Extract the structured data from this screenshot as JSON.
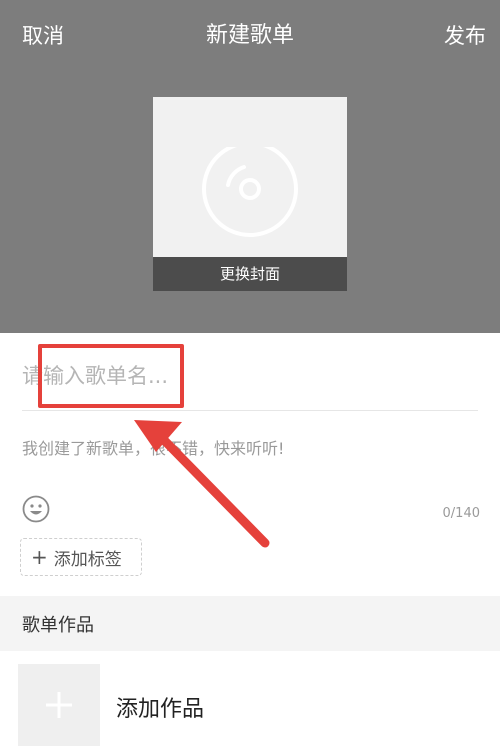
{
  "header": {
    "cancel_label": "取消",
    "title": "新建歌单",
    "publish_label": "发布",
    "background_color": "#7d7d7d"
  },
  "cover": {
    "icon": "disc-icon",
    "change_label": "更换封面"
  },
  "form": {
    "name_placeholder": "请输入歌单名...",
    "name_value": "",
    "description_placeholder": "我创建了新歌单，很不错，快来听听!",
    "emoji_icon": "smiley-icon",
    "char_counter": "0/140",
    "add_tag_label": "添加标签"
  },
  "works": {
    "section_title": "歌单作品",
    "add_label": "添加作品"
  },
  "annotation": {
    "color": "#e5413b"
  }
}
